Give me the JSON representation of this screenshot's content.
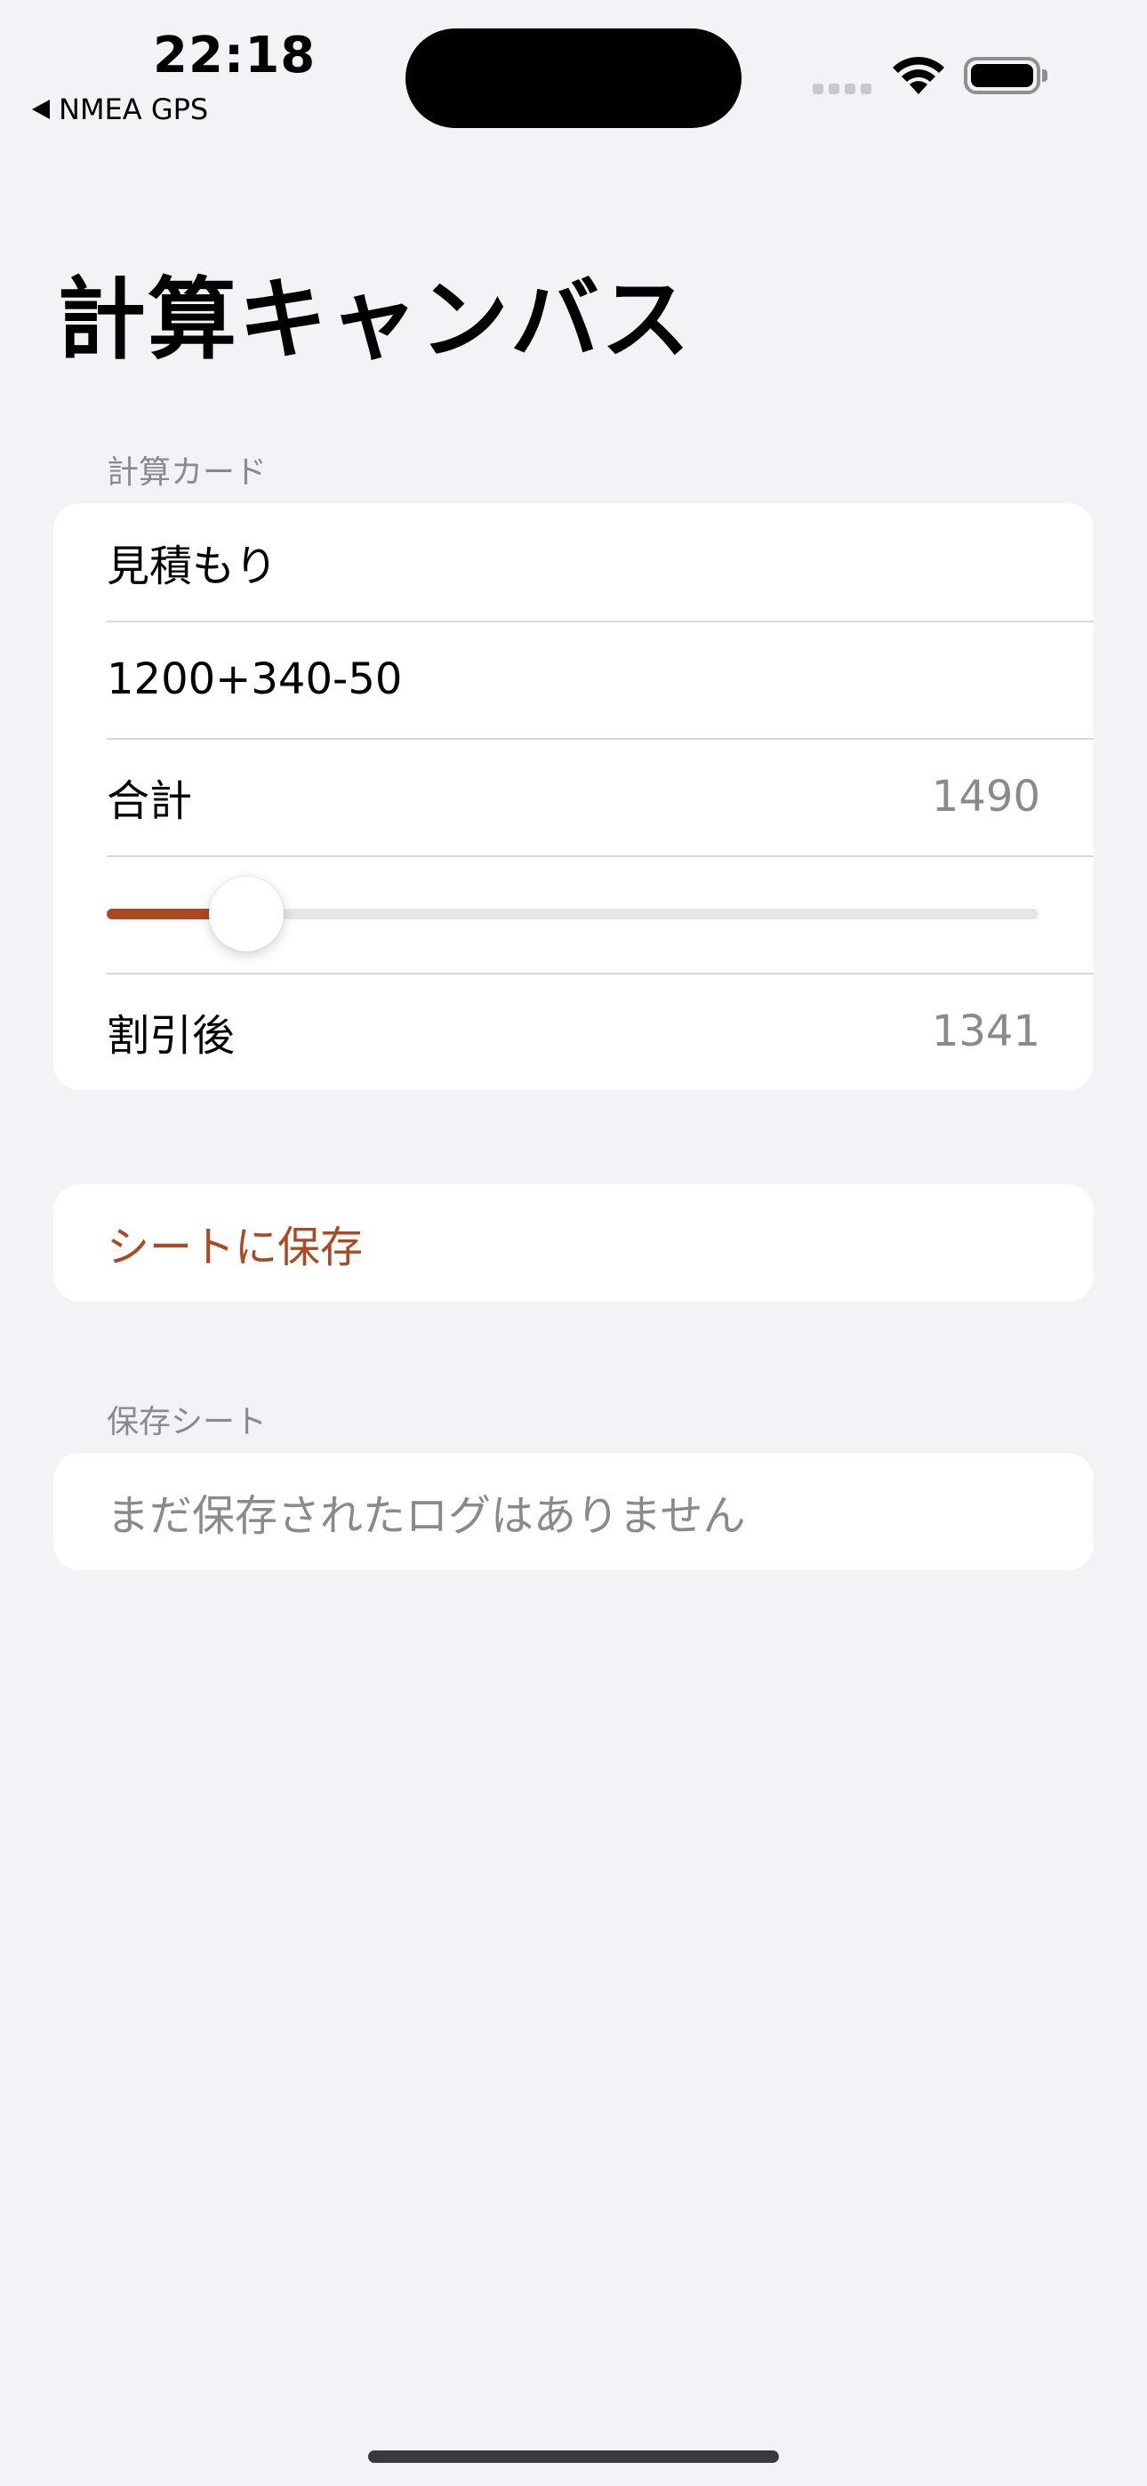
{
  "status_bar": {
    "time": "22:18",
    "back_app": "NMEA GPS"
  },
  "page": {
    "title": "計算キャンバス"
  },
  "calc_section": {
    "header": "計算カード",
    "name_value": "見積もり",
    "expression_value": "1200+340-50",
    "total_label": "合計",
    "total_value": "1490",
    "discount_fraction": 0.15,
    "discounted_label": "割引後",
    "discounted_value": "1341"
  },
  "save_button": {
    "label": "シートに保存"
  },
  "saved_section": {
    "header": "保存シート",
    "empty_message": "まだ保存されたログはありません"
  },
  "colors": {
    "accent": "#A94A25",
    "background": "#F2F2F7",
    "secondary_text": "#8A8A8E"
  }
}
